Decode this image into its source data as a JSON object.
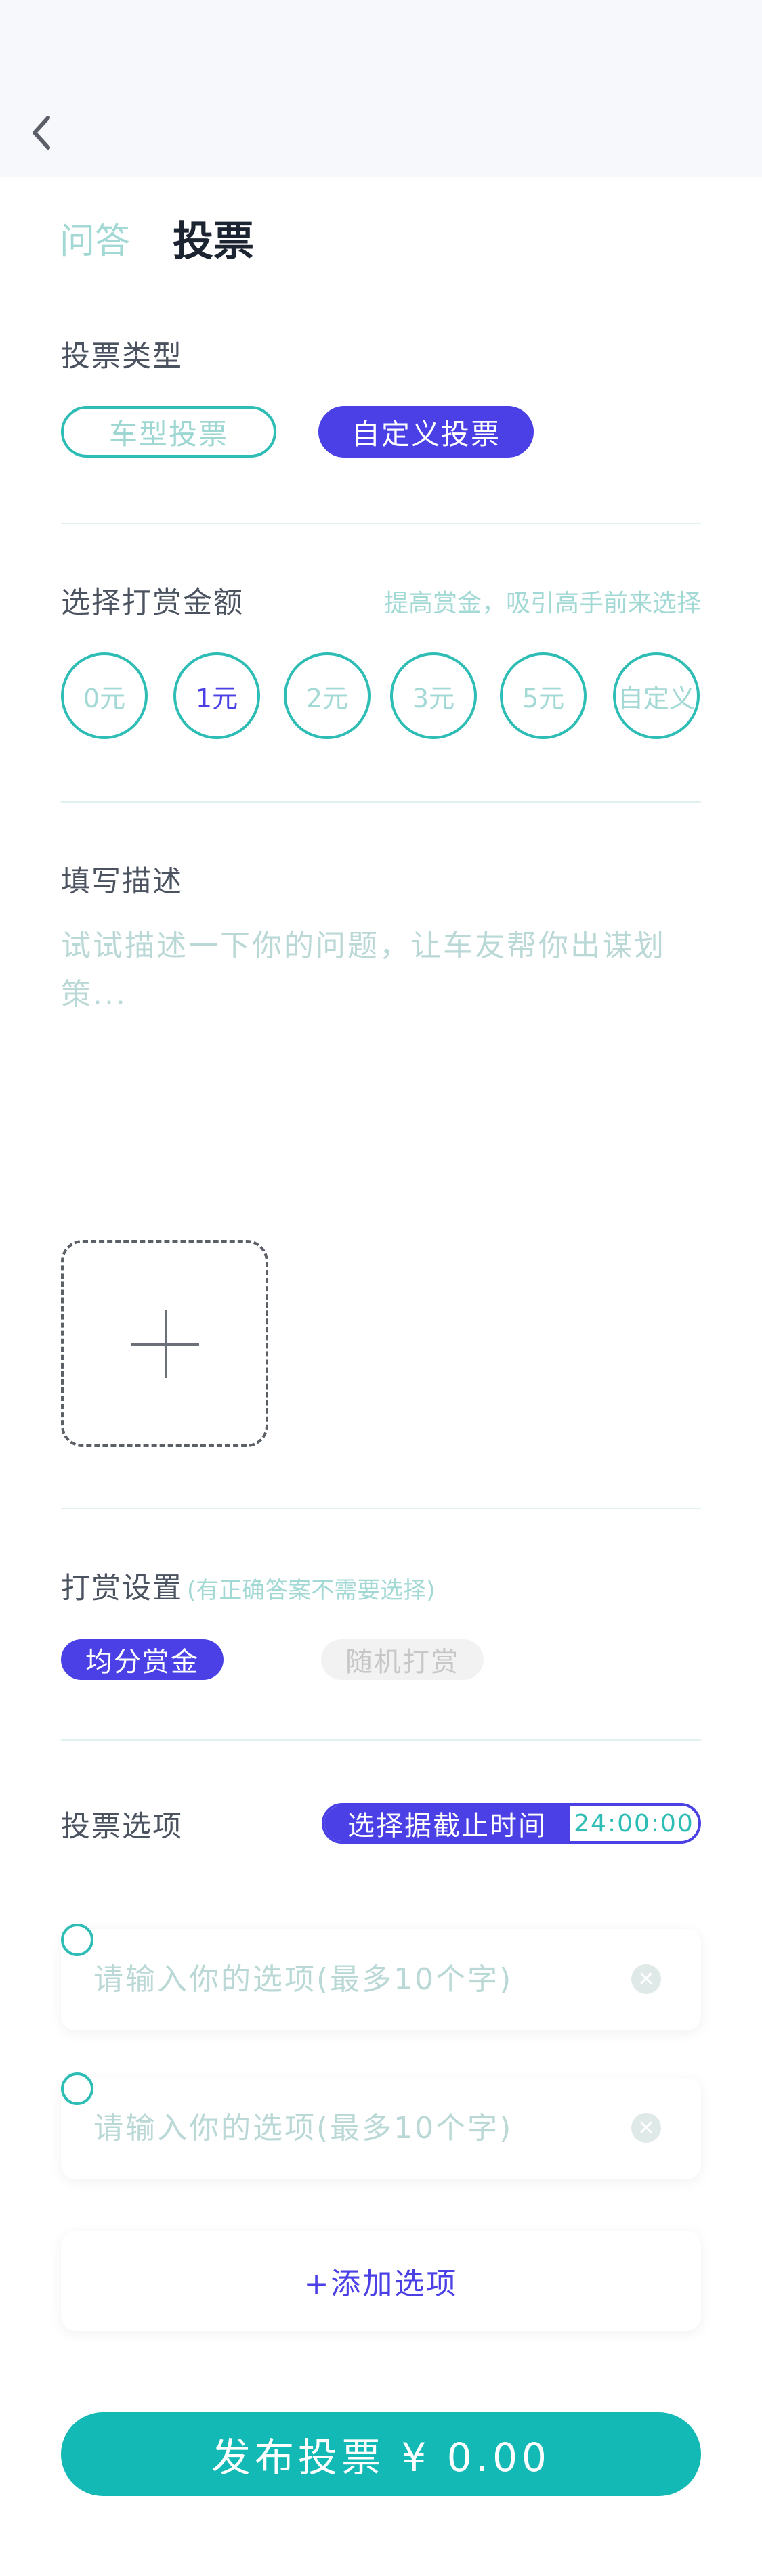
{
  "header": {
    "back_icon": "chevron-left-icon"
  },
  "tabs": [
    {
      "label": "问答",
      "active": false
    },
    {
      "label": "投票",
      "active": true
    }
  ],
  "vote_type": {
    "title": "投票类型",
    "options": [
      {
        "label": "车型投票",
        "selected": false
      },
      {
        "label": "自定义投票",
        "selected": true
      }
    ]
  },
  "reward_amount": {
    "title": "选择打赏金额",
    "hint": "提高赏金，吸引高手前来选择",
    "options": [
      {
        "label": "0元",
        "selected": false
      },
      {
        "label": "1元",
        "selected": true
      },
      {
        "label": "2元",
        "selected": false
      },
      {
        "label": "3元",
        "selected": false
      },
      {
        "label": "5元",
        "selected": false
      },
      {
        "label": "自定义",
        "selected": false
      }
    ]
  },
  "description": {
    "title": "填写描述",
    "placeholder": "试试描述一下你的问题，让车友帮你出谋划策..."
  },
  "upload": {
    "icon": "plus-icon"
  },
  "reward_settings": {
    "title": "打赏设置",
    "note": "(有正确答案不需要选择)",
    "options": [
      {
        "label": "均分赏金",
        "selected": true
      },
      {
        "label": "随机打赏",
        "selected": false
      }
    ]
  },
  "vote_options": {
    "title": "投票选项",
    "deadline_label": "选择据截止时间",
    "deadline_time": "24:00:00",
    "items": [
      {
        "placeholder": "请输入你的选项(最多10个字)"
      },
      {
        "placeholder": "请输入你的选项(最多10个字)"
      }
    ],
    "add_label": "+添加选项"
  },
  "publish": {
    "label": "发布投票 ¥ 0.00"
  },
  "colors": {
    "accent": "#13b9b5",
    "primary": "#4a40e6",
    "muted_text": "#a3d9d5"
  }
}
